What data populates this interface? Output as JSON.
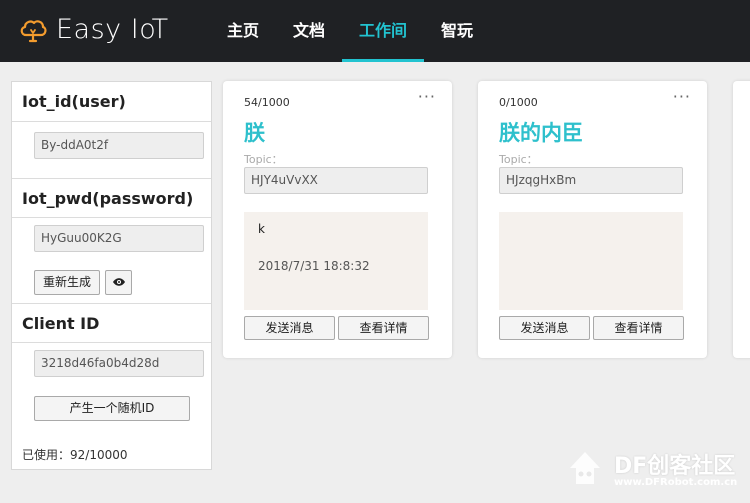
{
  "brand": {
    "name": "Easy IoT",
    "icon": "cloud-bulb-icon",
    "accent": "#f39c2e"
  },
  "nav": {
    "items": [
      {
        "label": "主页"
      },
      {
        "label": "文档"
      },
      {
        "label": "工作间",
        "active": true
      },
      {
        "label": "智玩"
      }
    ],
    "active_color": "#22c3d0"
  },
  "sidebar": {
    "iot_id_label": "Iot_id(user)",
    "iot_id_value": "By-ddA0t2f",
    "iot_pwd_label": "Iot_pwd(password)",
    "iot_pwd_value": "HyGuu00K2G",
    "regenerate_label": "重新生成",
    "show_password_icon": "eye-icon",
    "client_id_label": "Client ID",
    "client_id_value": "3218d46fa0b4d28d",
    "random_id_label": "产生一个随机ID",
    "usage": "已使用：92/10000"
  },
  "cards": [
    {
      "count": "54/1000",
      "menu": "···",
      "title": "朕",
      "topic_label": "Topic：",
      "topic": "HJY4uVvXX",
      "message": "k",
      "time": "2018/7/31 18:8:32",
      "send_label": "发送消息",
      "detail_label": "查看详情"
    },
    {
      "count": "0/1000",
      "menu": "···",
      "title": "朕的内臣",
      "topic_label": "Topic：",
      "topic": "HJzqgHxBm",
      "message": "",
      "time": "",
      "send_label": "发送消息",
      "detail_label": "查看详情"
    }
  ],
  "watermark": {
    "text": "DF创客社区",
    "sub": "www.DFRobot.com.cn"
  },
  "colors": {
    "title_teal": "#2ec0cc",
    "topbar": "#1f2124",
    "message_bg": "#f5f1ed"
  }
}
